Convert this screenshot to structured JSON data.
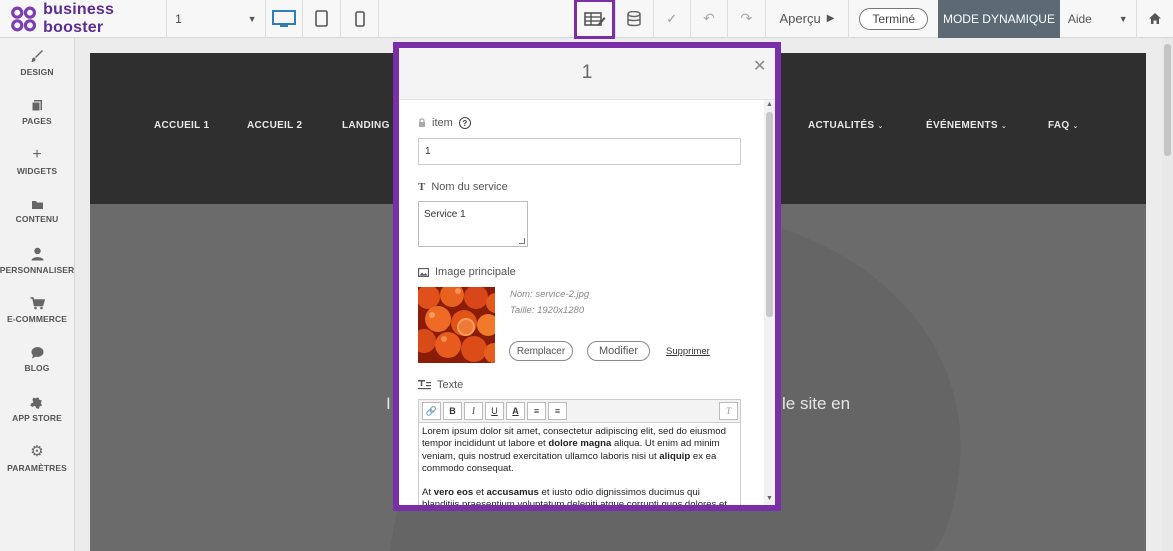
{
  "topbar": {
    "logo_text": "business booster",
    "page_select_value": "1",
    "apercu_label": "Aperçu",
    "termine_label": "Terminé",
    "mode_label": "MODE DYNAMIQUE",
    "aide_label": "Aide"
  },
  "sidebar": {
    "items": [
      {
        "label": "DESIGN",
        "icon": "brush-icon"
      },
      {
        "label": "PAGES",
        "icon": "pages-icon"
      },
      {
        "label": "WIDGETS",
        "icon": "plus-icon"
      },
      {
        "label": "CONTENU",
        "icon": "folder-icon"
      },
      {
        "label": "PERSONNALISER",
        "icon": "user-icon"
      },
      {
        "label": "E-COMMERCE",
        "icon": "cart-icon"
      },
      {
        "label": "BLOG",
        "icon": "chat-icon"
      },
      {
        "label": "APP STORE",
        "icon": "puzzle-icon"
      },
      {
        "label": "PARAMÈTRES",
        "icon": "gear-icon"
      }
    ]
  },
  "site": {
    "nav": [
      "ACCUEIL 1",
      "ACCUEIL 2",
      "LANDING P",
      "ACTUALITÉS",
      "ÉVÉNEMENTS",
      "FAQ"
    ],
    "hero_left": "I",
    "hero_right": "le site en"
  },
  "modal": {
    "title": "1",
    "item_label": "item",
    "item_value": "1",
    "service_label": "Nom du service",
    "service_value": "Service 1",
    "image_label": "Image principale",
    "image_name": "Nom: service-2.jpg",
    "image_size": "Taille: 1920x1280",
    "replace_label": "Remplacer",
    "modify_label": "Modifier",
    "delete_label": "Supprimer",
    "text_label": "Texte",
    "editor": {
      "p1_a": "Lorem ipsum dolor sit amet, consectetur adipiscing elit, sed do eiusmod tempor incididunt ut labore et ",
      "p1_b": "dolore magna",
      "p1_c": " aliqua. Ut enim ad minim veniam, quis nostrud exercitation ullamco laboris nisi ut ",
      "p1_d": "aliquip",
      "p1_e": " ex ea commodo consequat.",
      "p2_a": "At ",
      "p2_b": "vero eos",
      "p2_c": " et ",
      "p2_d": "accusamus",
      "p2_e": " et iusto odio dignissimos ducimus qui blanditiis praesentium voluptatum deleniti atque corrupti quos dolores et quas"
    }
  },
  "colors": {
    "accent_purple": "#7a2ea8",
    "mode_bg": "#5b6a74",
    "header_dark": "#2f2f2f",
    "canvas_gray": "#6b6b6b"
  }
}
